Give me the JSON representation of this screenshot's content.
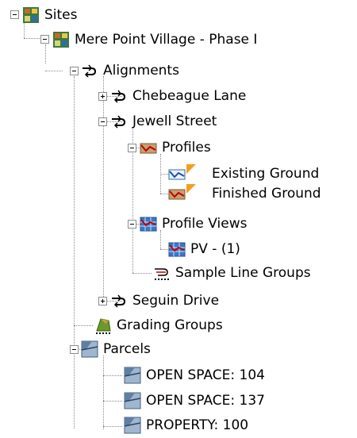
{
  "tree": {
    "sites": {
      "label": "Sites"
    },
    "site": {
      "label": "Mere Point Village - Phase I"
    },
    "alignments": {
      "label": "Alignments"
    },
    "chebeague": {
      "label": "Chebeague Lane"
    },
    "jewell": {
      "label": "Jewell Street"
    },
    "profiles": {
      "label": "Profiles"
    },
    "existing": {
      "label": "Existing Ground"
    },
    "finished": {
      "label": "Finished Ground"
    },
    "profile_views": {
      "label": "Profile Views"
    },
    "pv1": {
      "label": "PV - (1)"
    },
    "sample_lines": {
      "label": "Sample Line Groups"
    },
    "seguin": {
      "label": "Seguin Drive"
    },
    "grading": {
      "label": "Grading Groups"
    },
    "parcels": {
      "label": "Parcels"
    },
    "parcel1": {
      "label": "OPEN SPACE: 104"
    },
    "parcel2": {
      "label": "OPEN SPACE: 137"
    },
    "parcel3": {
      "label": "PROPERTY: 100"
    }
  }
}
